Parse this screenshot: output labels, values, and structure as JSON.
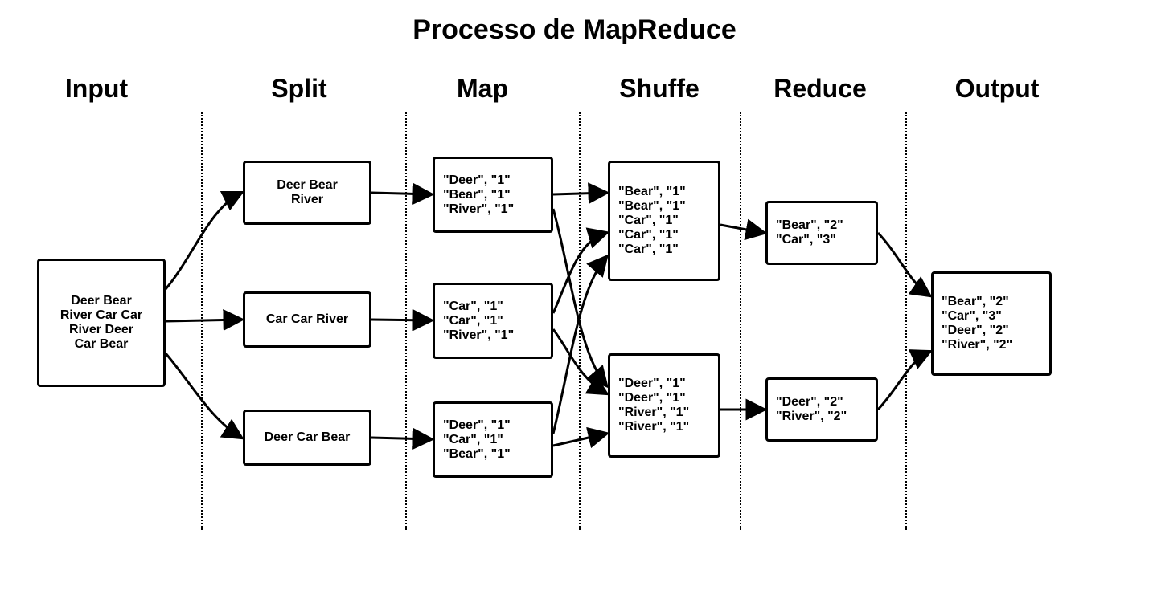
{
  "title": "Processo de MapReduce",
  "stages": [
    "Input",
    "Split",
    "Map",
    "Shuffe",
    "Reduce",
    "Output"
  ],
  "input_box": [
    "Deer Bear",
    "River Car Car",
    "River Deer",
    "Car Bear"
  ],
  "split_boxes": [
    [
      "Deer Bear",
      "River"
    ],
    [
      "Car Car River"
    ],
    [
      "Deer Car Bear"
    ]
  ],
  "map_boxes": [
    [
      "\"Deer\", \"1\"",
      "\"Bear\", \"1\"",
      "\"River\", \"1\""
    ],
    [
      "\"Car\", \"1\"",
      "\"Car\", \"1\"",
      "\"River\", \"1\""
    ],
    [
      "\"Deer\", \"1\"",
      "\"Car\", \"1\"",
      "\"Bear\", \"1\""
    ]
  ],
  "shuffle_boxes": [
    [
      "\"Bear\", \"1\"",
      "\"Bear\", \"1\"",
      "\"Car\", \"1\"",
      "\"Car\", \"1\"",
      "\"Car\", \"1\""
    ],
    [
      "\"Deer\", \"1\"",
      "\"Deer\", \"1\"",
      "\"River\", \"1\"",
      "\"River\", \"1\""
    ]
  ],
  "reduce_boxes": [
    [
      "\"Bear\", \"2\"",
      "\"Car\", \"3\""
    ],
    [
      "\"Deer\", \"2\"",
      "\"River\", \"2\""
    ]
  ],
  "output_box": [
    "\"Bear\", \"2\"",
    "\"Car\", \"3\"",
    "\"Deer\", \"2\"",
    "\"River\", \"2\""
  ]
}
